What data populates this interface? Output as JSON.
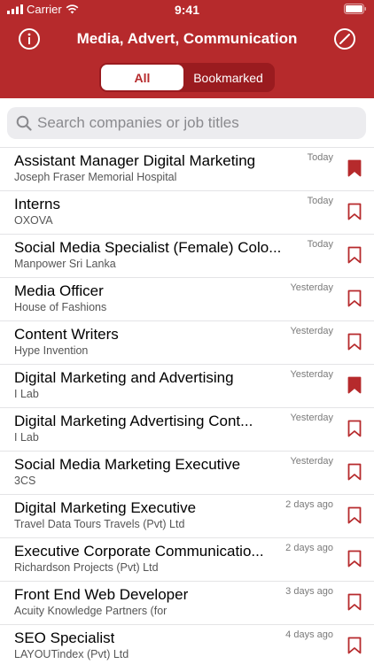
{
  "status": {
    "carrier": "Carrier",
    "time": "9:41"
  },
  "nav": {
    "title": "Media, Advert, Communication",
    "left_icon": "info-icon",
    "right_icon": "slash-circle-icon"
  },
  "segments": {
    "all": "All",
    "bookmarked": "Bookmarked",
    "selected": "All"
  },
  "search": {
    "placeholder": "Search companies or job titles"
  },
  "colors": {
    "brand": "#b62a2c",
    "segment_bg": "#9a1b1f"
  },
  "jobs": [
    {
      "title": "Assistant Manager Digital Marketing",
      "company": "Joseph Fraser Memorial Hospital",
      "date": "Today",
      "bookmarked": true
    },
    {
      "title": "Interns",
      "company": "OXOVA",
      "date": "Today",
      "bookmarked": false
    },
    {
      "title": "Social Media Specialist (Female)   Colo...",
      "company": "Manpower Sri Lanka",
      "date": "Today",
      "bookmarked": false
    },
    {
      "title": "Media Officer",
      "company": "House of Fashions",
      "date": "Yesterday",
      "bookmarked": false
    },
    {
      "title": "Content Writers",
      "company": "Hype Invention",
      "date": "Yesterday",
      "bookmarked": false
    },
    {
      "title": "Digital Marketing and Advertising",
      "company": "I Lab",
      "date": "Yesterday",
      "bookmarked": true
    },
    {
      "title": "Digital Marketing   Advertising   Cont...",
      "company": "I Lab",
      "date": "Yesterday",
      "bookmarked": false
    },
    {
      "title": "Social Media Marketing Executive",
      "company": "3CS",
      "date": "Yesterday",
      "bookmarked": false
    },
    {
      "title": "Digital Marketing Executive",
      "company": "Travel Data Tours   Travels (Pvt) Ltd",
      "date": "2 days ago",
      "bookmarked": false
    },
    {
      "title": "Executive   Corporate Communicatio...",
      "company": "Richardson Projects (Pvt) Ltd",
      "date": "2 days ago",
      "bookmarked": false
    },
    {
      "title": "Front End Web Developer",
      "company": "Acuity Knowledge Partners (for",
      "date": "3 days ago",
      "bookmarked": false
    },
    {
      "title": "SEO Specialist",
      "company": "LAYOUTindex (Pvt) Ltd",
      "date": "4 days ago",
      "bookmarked": false
    }
  ]
}
